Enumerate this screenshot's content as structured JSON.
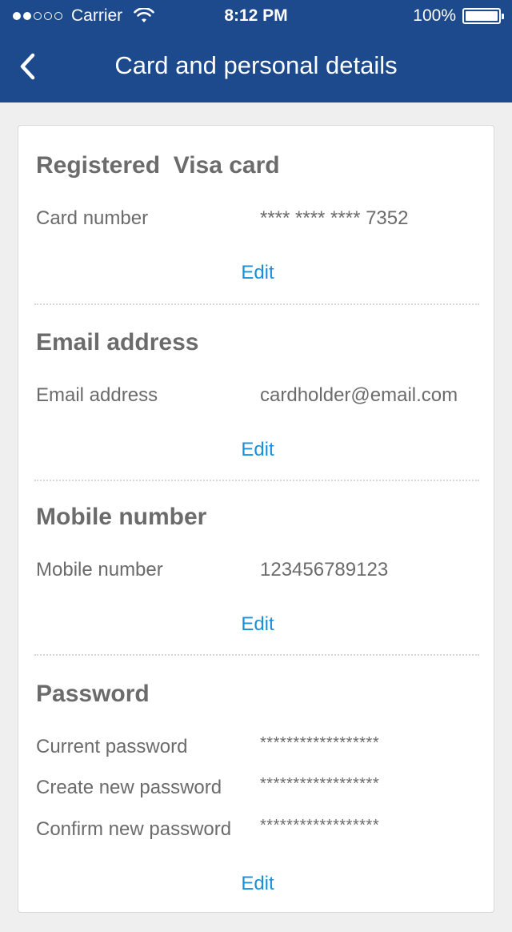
{
  "status_bar": {
    "carrier": "Carrier",
    "time": "8:12 PM",
    "battery": "100%"
  },
  "nav": {
    "title": "Card and personal details"
  },
  "sections": {
    "card": {
      "title": "Registered  Visa card",
      "label": "Card number",
      "value": "**** **** **** 7352",
      "edit": "Edit"
    },
    "email": {
      "title": "Email address",
      "label": "Email address",
      "value": "cardholder@email.com",
      "edit": "Edit"
    },
    "mobile": {
      "title": "Mobile number",
      "label": "Mobile number",
      "value": "123456789123",
      "edit": "Edit"
    },
    "password": {
      "title": "Password",
      "current_label": "Current password",
      "current_value": "******************",
      "new_label": "Create new password",
      "new_value": "******************",
      "confirm_label": "Confirm new password",
      "confirm_value": "******************",
      "edit": "Edit"
    }
  },
  "colors": {
    "nav_bar": "#1c4a8c",
    "link": "#1a8fd6",
    "text": "#6b6b6b",
    "background": "#efefef"
  }
}
